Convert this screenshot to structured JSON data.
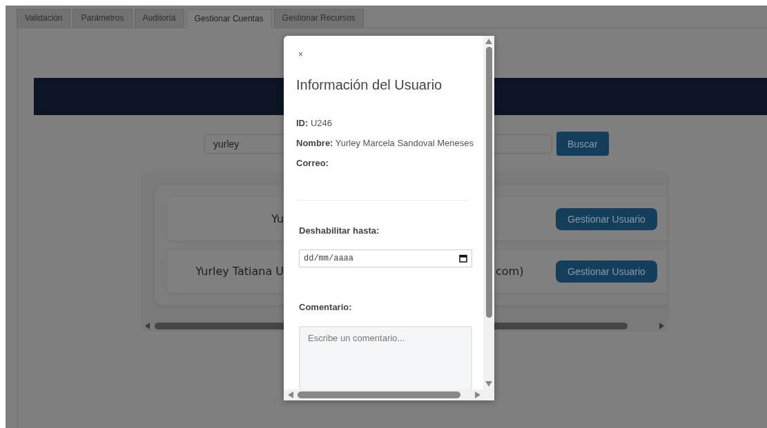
{
  "tabs": [
    {
      "label": "Validación",
      "selected": false
    },
    {
      "label": "Parámetros",
      "selected": false
    },
    {
      "label": "Auditoría",
      "selected": false
    },
    {
      "label": "Gestionar Cuentas",
      "selected": true
    },
    {
      "label": "Gestionar Recursos",
      "selected": false
    }
  ],
  "search": {
    "value": "yurley",
    "button": "Buscar"
  },
  "results": [
    {
      "text_left": "Yu",
      "button": "Gestionar Usuario"
    },
    {
      "text_left": "Yurley Tatiana U",
      "text_right": "com)",
      "button": "Gestionar Usuario"
    }
  ],
  "modal": {
    "close": "×",
    "title": "Información del Usuario",
    "fields": [
      {
        "label": "ID:",
        "value": "U246"
      },
      {
        "label": "Nombre:",
        "value": "Yurley Marcela Sandoval Meneses"
      },
      {
        "label": "Correo:"
      }
    ],
    "disable_label": "Deshabilitar hasta:",
    "date_placeholder": "dd/mm/aaaa",
    "comment_label": "Comentario:",
    "comment_placeholder": "Escribe un comentario..."
  }
}
